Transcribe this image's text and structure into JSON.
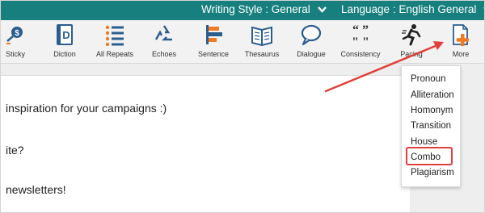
{
  "topbar": {
    "writing_style": "Writing Style : General",
    "language": "Language : English General"
  },
  "toolbar": {
    "items": [
      {
        "label": "Sticky",
        "icon": "sticky-icon"
      },
      {
        "label": "Diction",
        "icon": "diction-icon"
      },
      {
        "label": "All Repeats",
        "icon": "all-repeats-icon"
      },
      {
        "label": "Echoes",
        "icon": "echoes-icon"
      },
      {
        "label": "Sentence",
        "icon": "sentence-icon"
      },
      {
        "label": "Thesaurus",
        "icon": "thesaurus-icon"
      },
      {
        "label": "Dialogue",
        "icon": "dialogue-icon"
      },
      {
        "label": "Consistency",
        "icon": "consistency-icon"
      },
      {
        "label": "Pacing",
        "icon": "pacing-icon"
      },
      {
        "label": "More",
        "icon": "more-icon"
      }
    ]
  },
  "editor": {
    "lines": [
      "inspiration for your campaigns :)",
      "ite?",
      "newsletters!"
    ]
  },
  "more_menu": {
    "items": [
      "Pronoun",
      "Alliteration",
      "Homonym",
      "Transition",
      "House",
      "Combo",
      "Plagiarism"
    ]
  },
  "colors": {
    "topbar": "#17807e",
    "accent_orange": "#f07b22",
    "icon_blue": "#2c5d8f",
    "highlight_red": "#e0403a"
  }
}
